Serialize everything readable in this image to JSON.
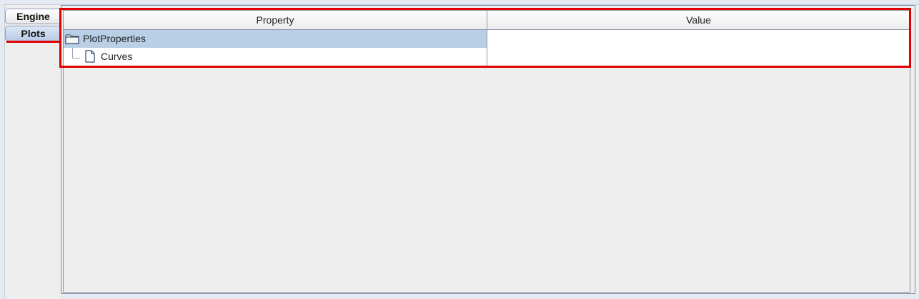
{
  "tabs": [
    {
      "label": "Engine",
      "selected": false
    },
    {
      "label": "Plots",
      "selected": true
    }
  ],
  "table": {
    "columns": [
      "Property",
      "Value"
    ],
    "rows": [
      {
        "property": "PlotProperties",
        "value": "",
        "icon": "folder-icon",
        "selected": true
      },
      {
        "property": "Curves",
        "value": "",
        "icon": "document-icon",
        "selected": false
      }
    ]
  },
  "colors": {
    "selection": "#b8cfe5",
    "annotation": "#e00000",
    "panel_background": "#eeeeee"
  }
}
